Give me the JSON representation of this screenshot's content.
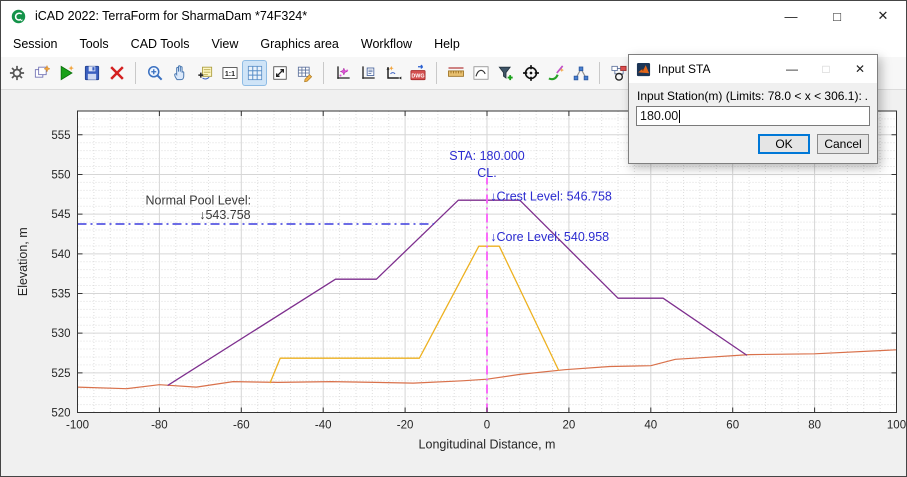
{
  "window": {
    "title": "iCAD 2022: TerraForm for SharmaDam *74F324*",
    "controls": {
      "minimize": "—",
      "maximize": "□",
      "close": "✕"
    }
  },
  "menu": {
    "items": [
      "Session",
      "Tools",
      "CAD Tools",
      "View",
      "Graphics area",
      "Workflow",
      "Help"
    ]
  },
  "toolbar": {
    "groups": [
      [
        {
          "name": "settings-gear"
        },
        {
          "name": "copy-objects"
        },
        {
          "name": "run-session"
        },
        {
          "name": "save-session"
        },
        {
          "name": "delete-object"
        }
      ],
      [
        {
          "name": "zoom-in"
        },
        {
          "name": "pan-hand"
        },
        {
          "name": "add-annotation"
        },
        {
          "name": "actual-size"
        },
        {
          "name": "grid-toggle",
          "active": true
        },
        {
          "name": "fit-to-window"
        },
        {
          "name": "edit-table"
        }
      ],
      [
        {
          "name": "plot-wizard"
        },
        {
          "name": "plot-document"
        },
        {
          "name": "axes-settings"
        },
        {
          "name": "export-dwg"
        }
      ],
      [
        {
          "name": "measure-ruler"
        },
        {
          "name": "curve-window"
        },
        {
          "name": "add-filter"
        },
        {
          "name": "target-point"
        },
        {
          "name": "magic-wand"
        },
        {
          "name": "polyline-nodes"
        }
      ],
      [
        {
          "name": "workflow-diagram"
        },
        {
          "name": "panel-return"
        },
        {
          "name": "workflow-lightning"
        }
      ]
    ]
  },
  "chart_data": {
    "type": "line",
    "xlabel": "Longitudinal Distance, m",
    "ylabel": "Elevation, m",
    "xlim": [
      -100,
      100
    ],
    "ylim": [
      520,
      558
    ],
    "xticks": [
      -100,
      -80,
      -60,
      -40,
      -20,
      0,
      20,
      40,
      60,
      80,
      100
    ],
    "yticks": [
      520,
      525,
      530,
      535,
      540,
      545,
      550,
      555
    ],
    "grid": {
      "major": true,
      "minor": true,
      "x_minor_step": 4,
      "y_minor_step": 1
    },
    "series": [
      {
        "name": "ground-surface",
        "color": "#d9714b",
        "width": 1.2,
        "style": "solid",
        "points": [
          [
            -100,
            523.2
          ],
          [
            -88,
            523.0
          ],
          [
            -80,
            523.5
          ],
          [
            -71,
            523.2
          ],
          [
            -62,
            523.9
          ],
          [
            -51,
            523.8
          ],
          [
            -38,
            523.9
          ],
          [
            -18,
            523.7
          ],
          [
            -6,
            524.0
          ],
          [
            0,
            524.2
          ],
          [
            8,
            524.8
          ],
          [
            19,
            525.4
          ],
          [
            30,
            525.8
          ],
          [
            40,
            525.9
          ],
          [
            46,
            526.7
          ],
          [
            52,
            526.9
          ],
          [
            64,
            527.3
          ],
          [
            80,
            527.4
          ],
          [
            100,
            527.9
          ]
        ]
      },
      {
        "name": "dam-embankment",
        "color": "#7e2f8e",
        "width": 1.3,
        "style": "solid",
        "points": [
          [
            -78,
            523.4
          ],
          [
            -37,
            536.8
          ],
          [
            -27,
            536.8
          ],
          [
            -7,
            546.758
          ],
          [
            8,
            546.758
          ],
          [
            32,
            534.4
          ],
          [
            43,
            534.4
          ],
          [
            63.5,
            527.2
          ]
        ]
      },
      {
        "name": "dam-core",
        "color": "#edb120",
        "width": 1.3,
        "style": "solid",
        "points": [
          [
            -53,
            523.7
          ],
          [
            -50.5,
            526.85
          ],
          [
            -16.5,
            526.85
          ],
          [
            -2,
            540.958
          ],
          [
            3,
            540.958
          ],
          [
            17.5,
            525.3
          ]
        ]
      },
      {
        "name": "normal-pool-level-line",
        "color": "#3c3cdd",
        "width": 1.4,
        "style": "dashdot",
        "points": [
          [
            -100,
            543.758
          ],
          [
            -13,
            543.758
          ]
        ]
      },
      {
        "name": "centerline",
        "color": "#f95cf9",
        "width": 1.8,
        "style": "dashdot",
        "points": [
          [
            0,
            520
          ],
          [
            0,
            549.6
          ]
        ]
      }
    ],
    "annotations": [
      {
        "text": "STA: 180.000",
        "x": 0,
        "y": 552.3,
        "color": "#2b2bd0",
        "anchor": "middle"
      },
      {
        "text": "CL.",
        "x": 0,
        "y": 550.2,
        "color": "#2b2bd0",
        "anchor": "middle"
      },
      {
        "text": "↓Crest Level: 546.758",
        "x": 0.8,
        "y": 547.2,
        "color": "#2b2bd0",
        "anchor": "start"
      },
      {
        "text": "↓Core Level: 540.958",
        "x": 0.8,
        "y": 542.1,
        "color": "#2b2bd0",
        "anchor": "start"
      },
      {
        "text": "Normal Pool Level:",
        "x": -70.5,
        "y": 546.7,
        "color": "#3a3a3a",
        "anchor": "middle"
      },
      {
        "text": "↓543.758",
        "x": -64,
        "y": 544.9,
        "color": "#3a3a3a",
        "anchor": "middle"
      }
    ],
    "colors": {
      "major_grid": "#d6d6d6",
      "minor_grid": "#dedede",
      "axis_box": "#333333",
      "tick_label": "#262626"
    }
  },
  "dialog": {
    "title": "Input STA",
    "controls": {
      "minimize": "—",
      "maximize": "□",
      "close": "✕"
    },
    "label": "Input Station(m) (Limits:  78.0 < x < 306.1):",
    "label_suffix": ".",
    "value": "180.00",
    "ok_label": "OK",
    "cancel_label": "Cancel"
  }
}
